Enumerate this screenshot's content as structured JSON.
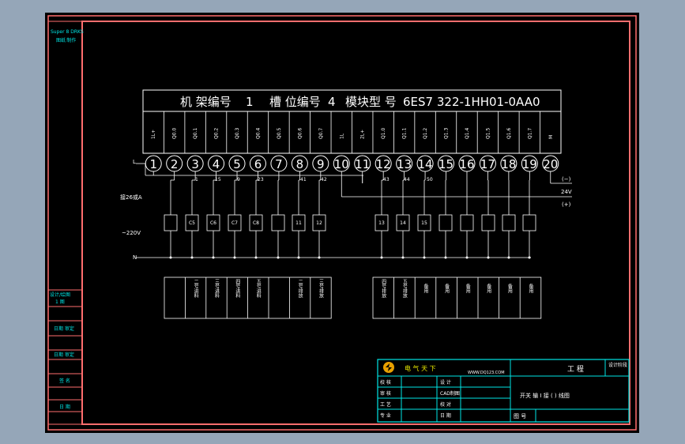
{
  "side_labels": {
    "brand": "Super 8 DRKS",
    "brand_sub": "图纸 制作",
    "row1a": "设计/绘图",
    "row1b": "1 图",
    "row2": "日期 审定",
    "row3": "日期 审定",
    "row4": "签 名",
    "row5": "日 期"
  },
  "header": {
    "rack_label": "机 架编号",
    "rack_no": "1",
    "slot_label": "槽 位编号",
    "slot_no": "4",
    "module_label": "模块型 号",
    "module_no": "6ES7  322-1HH01-0AA0"
  },
  "channels": [
    "1L+",
    "Q0.0",
    "Q0.1",
    "Q0.2",
    "Q0.3",
    "Q0.4",
    "Q0.5",
    "Q0.6",
    "Q0.7",
    "1L",
    "2L+",
    "Q1.0",
    "Q1.1",
    "Q1.2",
    "Q1.3",
    "Q1.4",
    "Q1.5",
    "Q1.6",
    "Q1.7",
    "M"
  ],
  "terminals": [
    "1",
    "2",
    "3",
    "4",
    "5",
    "6",
    "7",
    "8",
    "9",
    "10",
    "11",
    "12",
    "13",
    "14",
    "15",
    "16",
    "17",
    "18",
    "19",
    "20"
  ],
  "wire_numbers": [
    "1",
    "15",
    "9",
    "23",
    "41",
    "42",
    "43",
    "44",
    "50"
  ],
  "left_labels": {
    "L": "L",
    "note": "接26或A",
    "voltage": "~220V",
    "N": "N"
  },
  "right_labels": {
    "minus": "(−)",
    "v24": "24V",
    "plus": "(+)"
  },
  "relays": [
    "",
    "C5",
    "C6",
    "C7",
    "C8",
    "",
    "11",
    "12",
    "13",
    "14",
    "15",
    "",
    "",
    "",
    ""
  ],
  "table_left": [
    "",
    "二号进料",
    "三号进料",
    "四号进料",
    "五号进料",
    "",
    "二号排放",
    "三号排放"
  ],
  "table_right": [
    "四号排放",
    "五号排放",
    "备用",
    "备用",
    "备用",
    "备用",
    "备用",
    "备用"
  ],
  "title_block": {
    "company": "电 气 天 下",
    "website": "WWW.DQ123.COM",
    "project": "工 程",
    "design_stage": "设计阶段",
    "rows": [
      {
        "a": "校 核",
        "b": "设 计"
      },
      {
        "a": "审 核",
        "b": "CAD制图"
      },
      {
        "a": "工 艺",
        "b": "校 对"
      },
      {
        "a": "专 业",
        "b": "日 期"
      }
    ],
    "drawing_title": "开关 输 I 接 ( ) 线图",
    "drawing_no": "图 号"
  },
  "colors": {
    "border": "#ff6e6e",
    "line": "#ffffff",
    "title_cyan": "#00e5e5",
    "logo": "#e8a000",
    "background": "#000000"
  }
}
